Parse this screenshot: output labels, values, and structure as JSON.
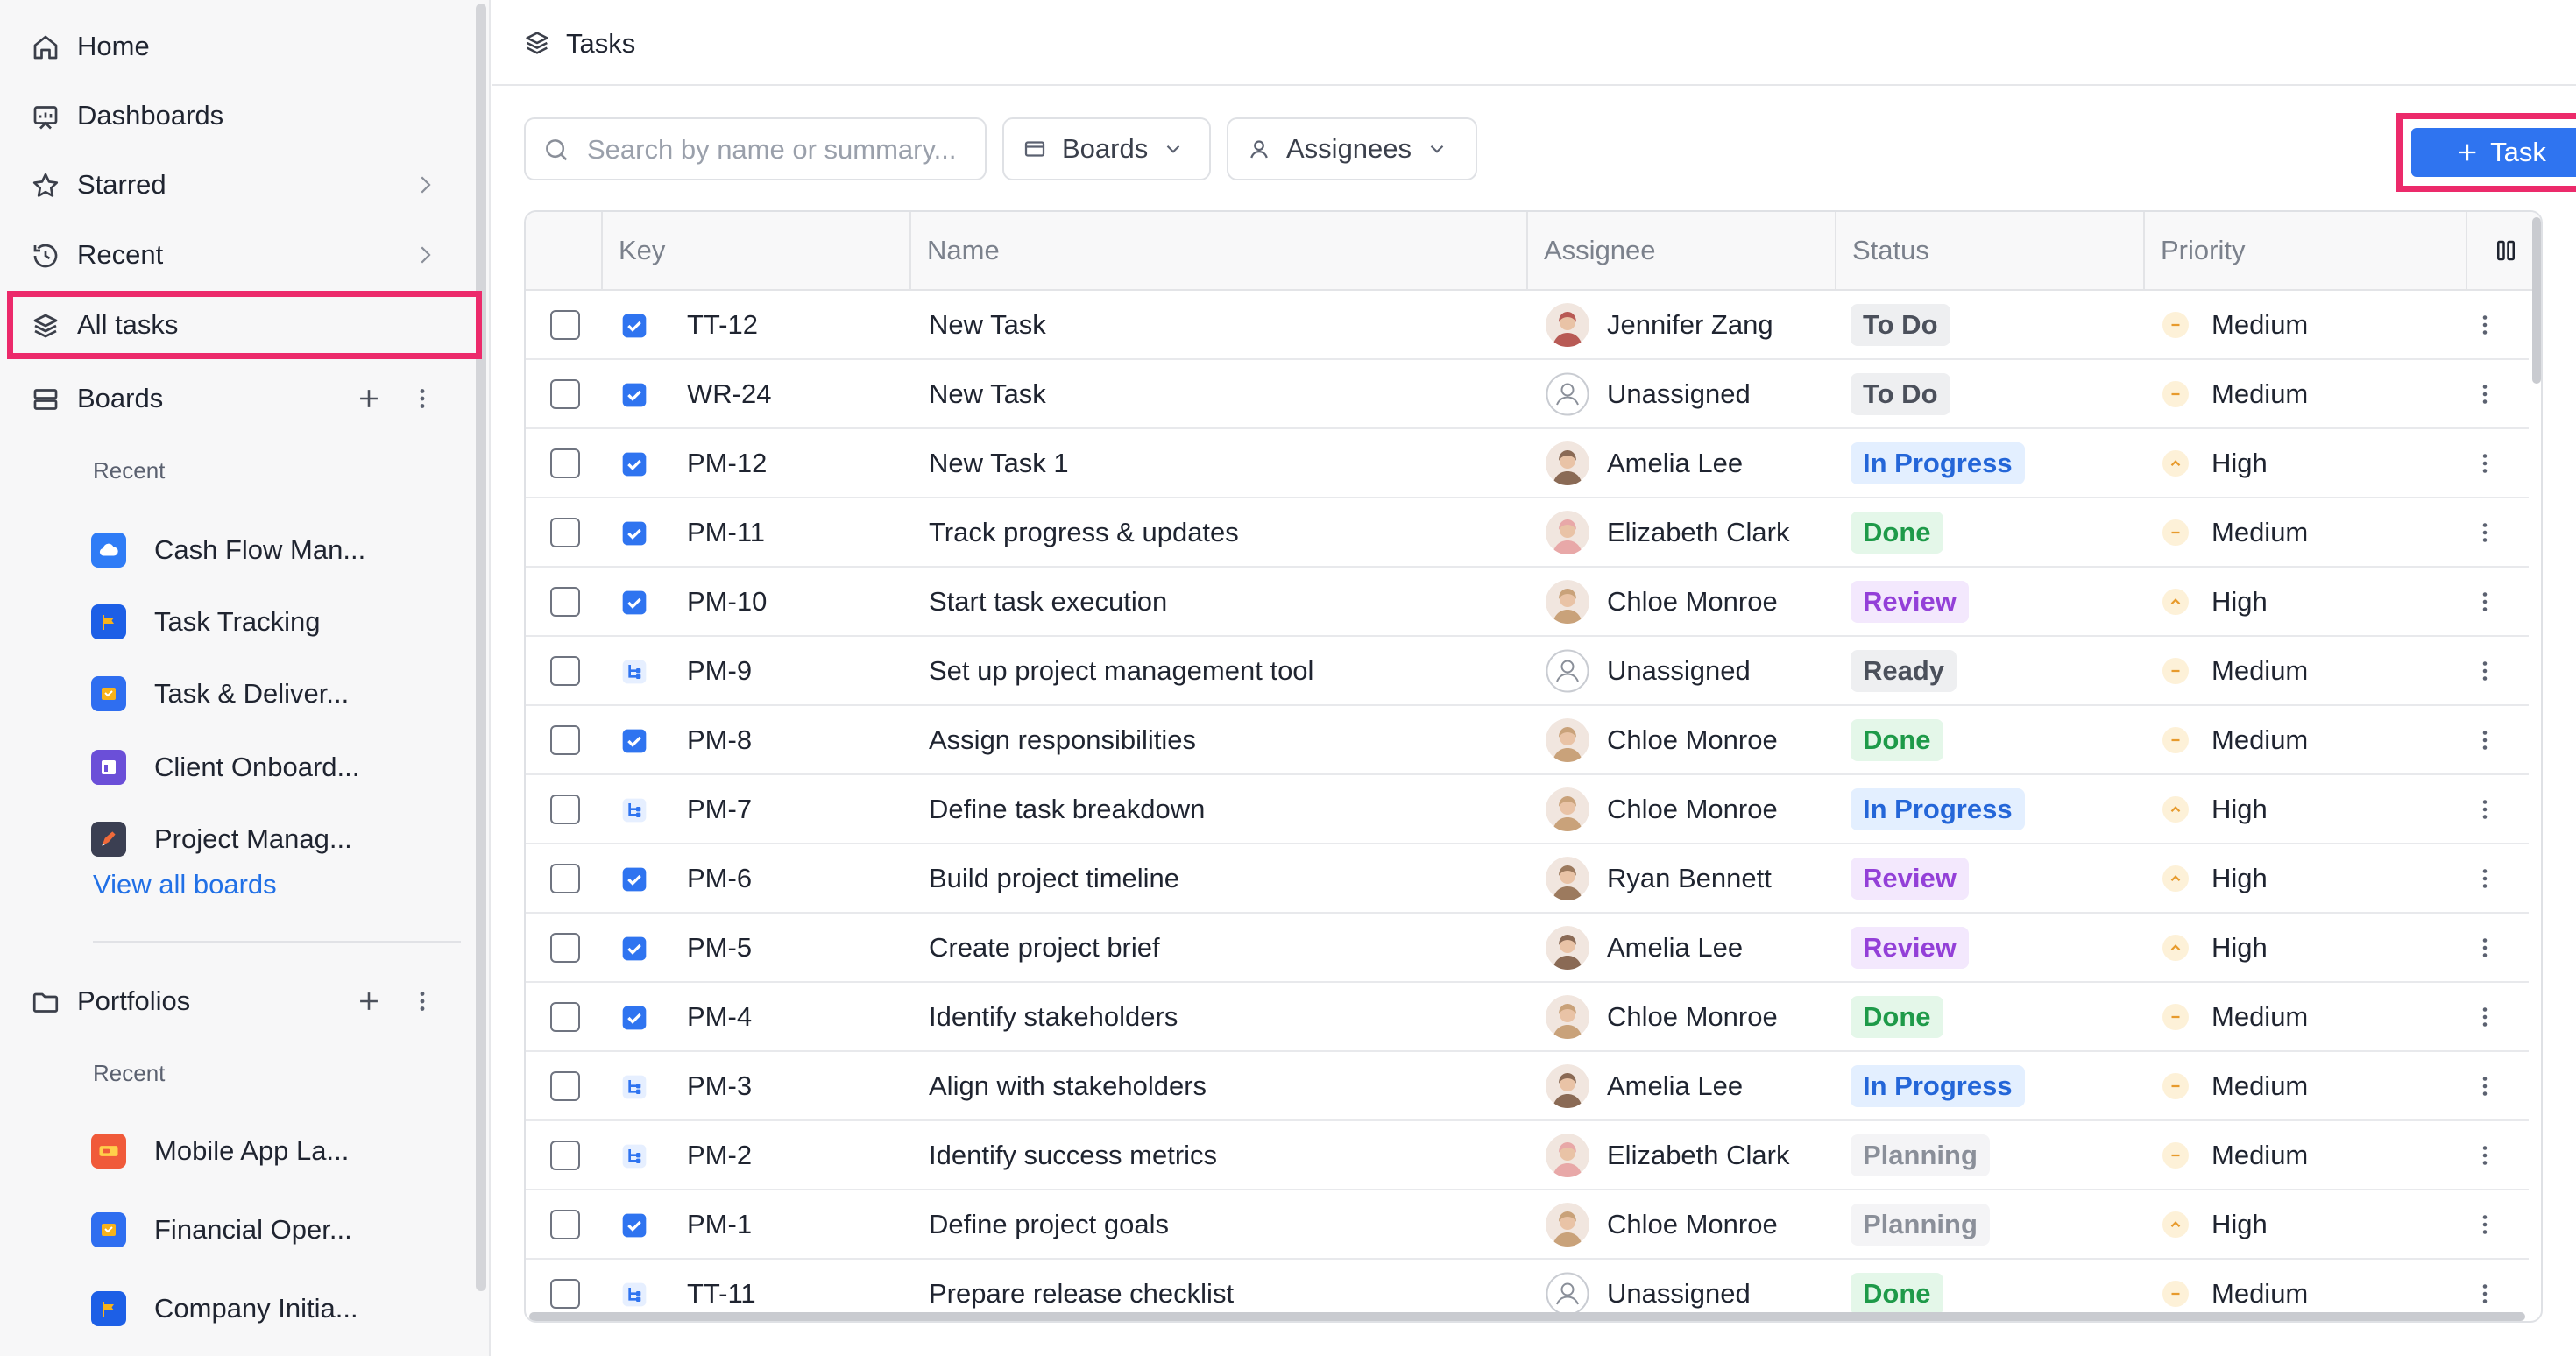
{
  "sidebar": {
    "nav": [
      {
        "label": "Home",
        "icon": "home-icon"
      },
      {
        "label": "Dashboards",
        "icon": "dashboard-icon"
      },
      {
        "label": "Starred",
        "icon": "star-icon"
      },
      {
        "label": "Recent",
        "icon": "history-icon"
      },
      {
        "label": "All tasks",
        "icon": "layers-icon",
        "active": true
      },
      {
        "label": "Boards",
        "icon": "boards-icon"
      }
    ],
    "boards_recent_label": "Recent",
    "boards": [
      {
        "label": "Cash Flow Man...",
        "color": "#2f7cf6"
      },
      {
        "label": "Task Tracking",
        "color": "#1d5fe6"
      },
      {
        "label": "Task & Deliver...",
        "color": "#2f6ef0"
      },
      {
        "label": "Client Onboard...",
        "color": "#6b4fd8"
      },
      {
        "label": "Project Manag...",
        "color": "#3b3f52"
      }
    ],
    "view_all_boards": "View all boards",
    "portfolios_label": "Portfolios",
    "portfolios_recent_label": "Recent",
    "portfolios": [
      {
        "label": "Mobile App La...",
        "color": "#f05a3a"
      },
      {
        "label": "Financial Oper...",
        "color": "#2f6ef0"
      },
      {
        "label": "Company Initia...",
        "color": "#1d5fe6"
      }
    ]
  },
  "header": {
    "title": "Tasks"
  },
  "toolbar": {
    "search_placeholder": "Search by name or summary...",
    "boards_filter": "Boards",
    "assignees_filter": "Assignees",
    "add_task": "Task"
  },
  "table": {
    "columns": [
      "Key",
      "Name",
      "Assignee",
      "Status",
      "Priority"
    ],
    "rows": [
      {
        "type": "task",
        "key": "TT-12",
        "name": "New Task",
        "assignee": "Jennifer Zang",
        "avatar": "#b85a55",
        "status": "To Do",
        "priority": "Medium"
      },
      {
        "type": "task",
        "key": "WR-24",
        "name": "New Task",
        "assignee": "Unassigned",
        "avatar": "",
        "status": "To Do",
        "priority": "Medium"
      },
      {
        "type": "task",
        "key": "PM-12",
        "name": "New Task 1",
        "assignee": "Amelia Lee",
        "avatar": "#8a6a55",
        "status": "In Progress",
        "priority": "High"
      },
      {
        "type": "task",
        "key": "PM-11",
        "name": "Track progress & updates",
        "assignee": "Elizabeth Clark",
        "avatar": "#e8a8a8",
        "status": "Done",
        "priority": "Medium"
      },
      {
        "type": "task",
        "key": "PM-10",
        "name": "Start task execution",
        "assignee": "Chloe Monroe",
        "avatar": "#c9a27a",
        "status": "Review",
        "priority": "High"
      },
      {
        "type": "subtask",
        "key": "PM-9",
        "name": "Set up project management tool",
        "assignee": "Unassigned",
        "avatar": "",
        "status": "Ready",
        "priority": "Medium"
      },
      {
        "type": "task",
        "key": "PM-8",
        "name": "Assign responsibilities",
        "assignee": "Chloe Monroe",
        "avatar": "#c9a27a",
        "status": "Done",
        "priority": "Medium"
      },
      {
        "type": "subtask",
        "key": "PM-7",
        "name": "Define task breakdown",
        "assignee": "Chloe Monroe",
        "avatar": "#c9a27a",
        "status": "In Progress",
        "priority": "High"
      },
      {
        "type": "task",
        "key": "PM-6",
        "name": "Build project timeline",
        "assignee": "Ryan Bennett",
        "avatar": "#9c7a5e",
        "status": "Review",
        "priority": "High"
      },
      {
        "type": "task",
        "key": "PM-5",
        "name": "Create project brief",
        "assignee": "Amelia Lee",
        "avatar": "#8a6a55",
        "status": "Review",
        "priority": "High"
      },
      {
        "type": "task",
        "key": "PM-4",
        "name": "Identify stakeholders",
        "assignee": "Chloe Monroe",
        "avatar": "#c9a27a",
        "status": "Done",
        "priority": "Medium"
      },
      {
        "type": "subtask",
        "key": "PM-3",
        "name": "Align with stakeholders",
        "assignee": "Amelia Lee",
        "avatar": "#8a6a55",
        "status": "In Progress",
        "priority": "Medium"
      },
      {
        "type": "subtask",
        "key": "PM-2",
        "name": "Identify success metrics",
        "assignee": "Elizabeth Clark",
        "avatar": "#e8a8a8",
        "status": "Planning",
        "priority": "Medium"
      },
      {
        "type": "task",
        "key": "PM-1",
        "name": "Define project goals",
        "assignee": "Chloe Monroe",
        "avatar": "#c9a27a",
        "status": "Planning",
        "priority": "High"
      },
      {
        "type": "subtask",
        "key": "TT-11",
        "name": "Prepare release checklist",
        "assignee": "Unassigned",
        "avatar": "",
        "status": "Done",
        "priority": "Medium"
      }
    ]
  },
  "status_styles": {
    "To Do": {
      "bg": "#eeeff1",
      "fg": "#4b505b"
    },
    "In Progress": {
      "bg": "#e3efff",
      "fg": "#2466d8"
    },
    "Done": {
      "bg": "#e4f7e9",
      "fg": "#1e9a49"
    },
    "Review": {
      "bg": "#f3e8fd",
      "fg": "#9340d8"
    },
    "Ready": {
      "bg": "#eeeff1",
      "fg": "#4b505b"
    },
    "Planning": {
      "bg": "#f4f4f6",
      "fg": "#8a8f99"
    }
  },
  "colors": {
    "accent": "#2f74f0",
    "highlight": "#ec2a6b",
    "priority_bg": "#fdf1d8",
    "priority_fg": "#e79a2c"
  }
}
